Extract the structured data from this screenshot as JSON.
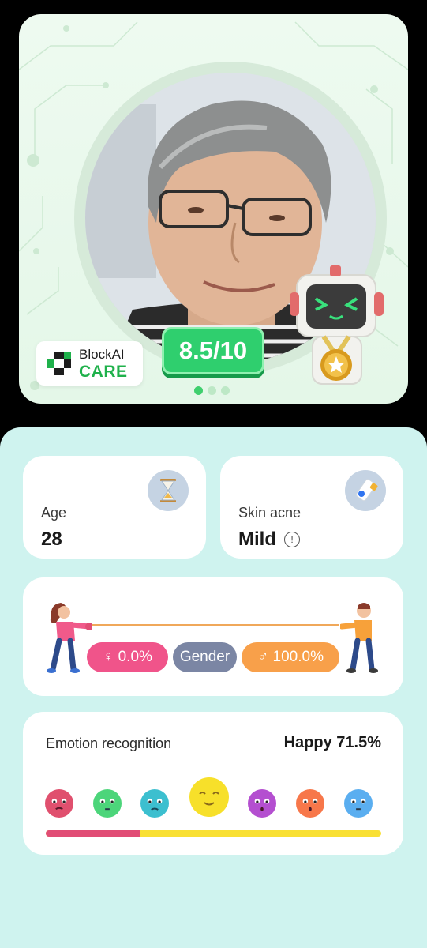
{
  "brand": {
    "line1": "BlockAI",
    "line2": "CARE"
  },
  "score": "8.5/10",
  "carousel": {
    "dots": 3,
    "active": 0
  },
  "age": {
    "label": "Age",
    "value": "28",
    "icon": "hourglass-icon"
  },
  "skin_acne": {
    "label": "Skin acne",
    "value": "Mild",
    "icon": "skincare-icon",
    "info": "!"
  },
  "gender": {
    "female": "♀ 0.0%",
    "label": "Gender",
    "male": "♂ 100.0%"
  },
  "emotion": {
    "title": "Emotion recognition",
    "result": "Happy 71.5%",
    "faces": [
      {
        "name": "angry-face-icon",
        "color": "#e0506e"
      },
      {
        "name": "disgust-face-icon",
        "color": "#4cd57a"
      },
      {
        "name": "sad-face-icon",
        "color": "#3cbfcf"
      },
      {
        "name": "happy-face-icon",
        "color": "#f7e02a"
      },
      {
        "name": "fear-face-icon",
        "color": "#b44fd0"
      },
      {
        "name": "surprise-face-icon",
        "color": "#f7774a"
      },
      {
        "name": "neutral-face-icon",
        "color": "#5aaef0"
      }
    ],
    "selected": 3,
    "bar_fraction": 0.28
  },
  "colors": {
    "accent_green": "#2fcf6e",
    "panel_bg": "#cff3ef",
    "female_pink": "#f0548a",
    "male_orange": "#f8a04a"
  }
}
